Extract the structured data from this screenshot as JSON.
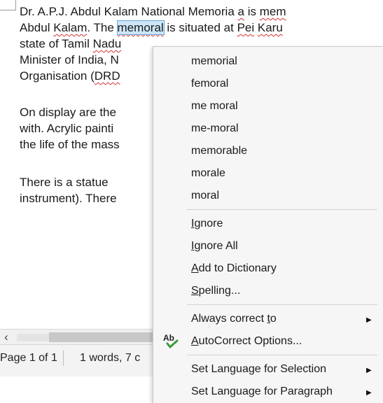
{
  "document": {
    "lines": [
      {
        "segments": [
          {
            "t": "Dr. A.P.J. Abdul Kalam National Memoria "
          },
          {
            "t": "a",
            "sq": true
          },
          {
            "t": " is "
          },
          {
            "t": "mem",
            "sq": true
          }
        ]
      },
      {
        "segments": [
          {
            "t": "Abdul "
          },
          {
            "t": "Kalam",
            "sq": true
          },
          {
            "t": ". The "
          },
          {
            "t": "memoral",
            "hl": true,
            "sq": true
          },
          {
            "t": " is situated at "
          },
          {
            "t": "Pei",
            "sq": true
          },
          {
            "t": " "
          },
          {
            "t": "Karu",
            "sq": true
          }
        ]
      },
      {
        "segments": [
          {
            "t": "state of Tamil "
          },
          {
            "t": "Nadu",
            "sq": true
          }
        ]
      },
      {
        "segments": [
          {
            "t": "Minister of India, N"
          }
        ]
      },
      {
        "segments": [
          {
            "t": "Organisation ("
          },
          {
            "t": "DRD",
            "sq": true
          }
        ]
      },
      {
        "segments": [
          {
            "t": "On display are the"
          }
        ]
      },
      {
        "segments": [
          {
            "t": "with. Acrylic painti"
          }
        ]
      },
      {
        "segments": [
          {
            "t": "the life of the mass"
          }
        ]
      },
      {
        "segments": [
          {
            "t": "There is a statue"
          }
        ]
      },
      {
        "segments": [
          {
            "t": "instrument). There"
          }
        ]
      }
    ]
  },
  "scrollbar": {
    "left_arrow": "‹"
  },
  "status_bar": {
    "page": "Page 1 of 1",
    "words": "1 words, 7 c"
  },
  "context_menu": {
    "suggestions": [
      "memorial",
      "femoral",
      "me moral",
      "me-moral",
      "memorable",
      "morale",
      "moral"
    ],
    "ignore": "Ignore",
    "ignore_all": "Ignore All",
    "add_to_dictionary": "Add to Dictionary",
    "spelling": "Spelling...",
    "always_correct_to": "Always correct to",
    "autocorrect_options": "AutoCorrect Options...",
    "set_language_selection": "Set Language for Selection",
    "set_language_paragraph": "Set Language for Paragraph"
  },
  "colors": {
    "highlight": "#cde6f7",
    "squiggle": "#d03030",
    "menu_bg": "#f6f6f6"
  }
}
